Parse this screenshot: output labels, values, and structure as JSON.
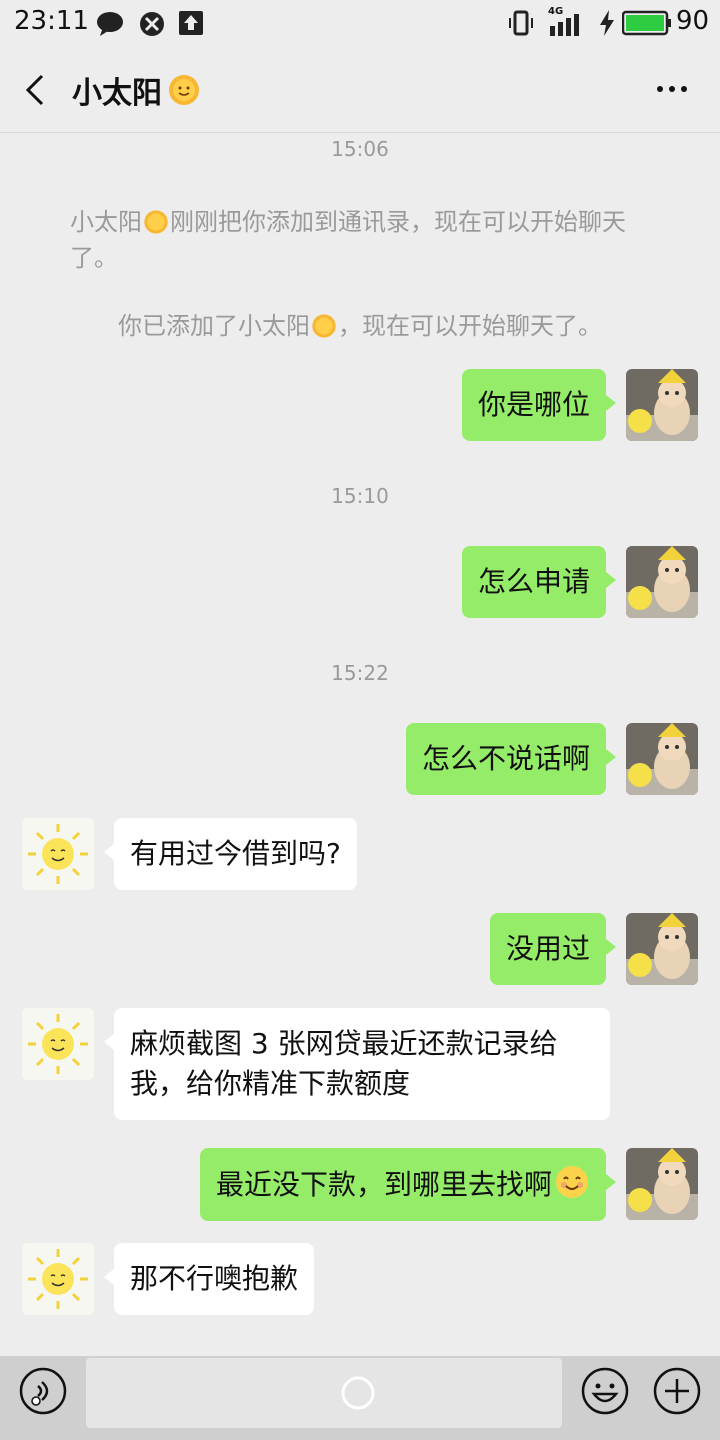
{
  "status_bar": {
    "time": "23:11",
    "network": "4G",
    "battery": "90",
    "battery_color": "#2ecc40"
  },
  "header": {
    "title": "小太阳",
    "title_icon": "sun-emoji-icon"
  },
  "chat": {
    "timestamps": [
      "15:06",
      "15:10",
      "15:22"
    ],
    "system_1_a": "小太阳",
    "system_1_b": "刚刚把你添加到通讯录，现在可以开始聊天",
    "system_1_c": "了。",
    "system_2_a": "你已添加了小太阳",
    "system_2_b": "，现在可以开始聊天了。",
    "messages": [
      {
        "from": "me",
        "text": "你是哪位"
      },
      {
        "from": "me",
        "text": "怎么申请"
      },
      {
        "from": "me",
        "text": "怎么不说话啊"
      },
      {
        "from": "other",
        "text": "有用过今借到吗?"
      },
      {
        "from": "me",
        "text": "没用过"
      },
      {
        "from": "other",
        "text_line1": "麻烦截图 3 张网贷最近还款记录给",
        "text_line2": "我，给你精准下款额度"
      },
      {
        "from": "me",
        "text": "最近没下款，到哪里去找啊",
        "emoji": "smiling-face-icon"
      },
      {
        "from": "other",
        "text": "那不行噢抱歉"
      }
    ]
  },
  "colors": {
    "my_bubble": "#95ec69",
    "other_bubble": "#ffffff",
    "background": "#ededed"
  }
}
